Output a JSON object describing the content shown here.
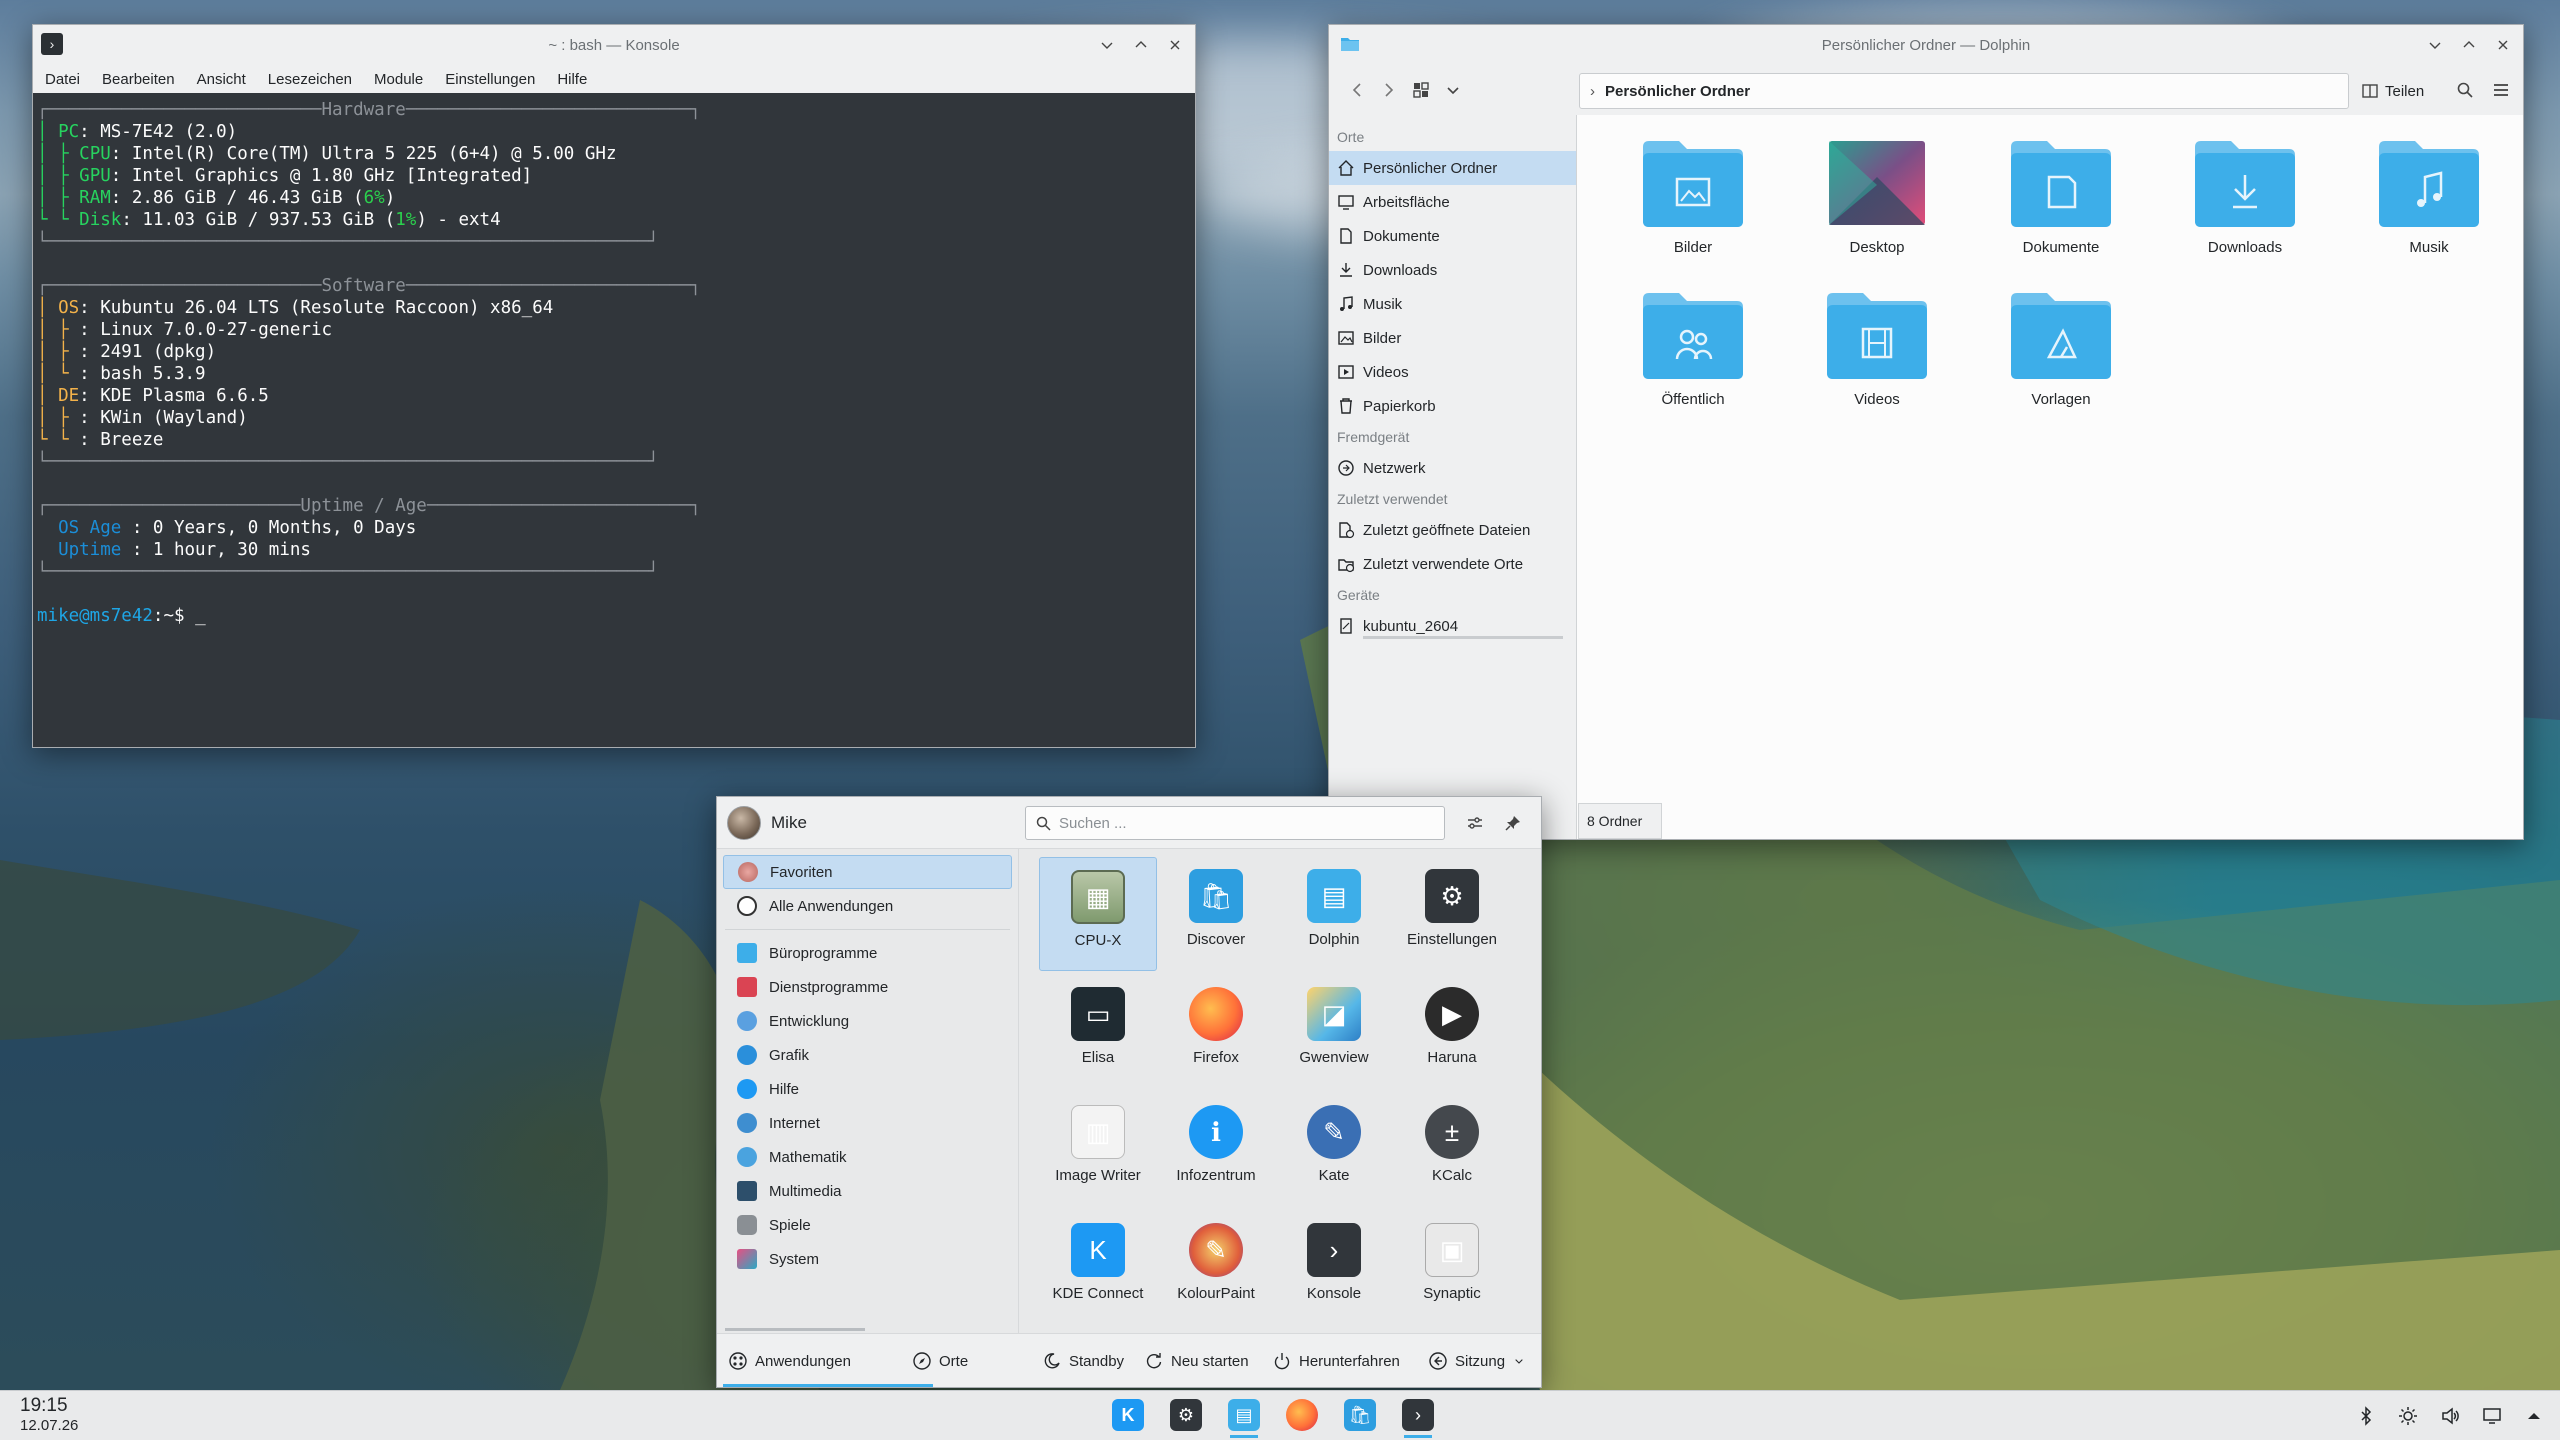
{
  "konsole": {
    "title": "~ : bash — Konsole",
    "menu": [
      "Datei",
      "Bearbeiten",
      "Ansicht",
      "Lesezeichen",
      "Module",
      "Einstellungen",
      "Hilfe"
    ],
    "sections": {
      "hardware": "Hardware",
      "software": "Software",
      "uptime": "Uptime / Age"
    },
    "hardware": [
      {
        "label": "PC",
        "value": ": MS-7E42 (2.0)"
      },
      {
        "label": "CPU",
        "value": ": Intel(R) Core(TM) Ultra 5 225 (6+4) @ 5.00 GHz"
      },
      {
        "label": "GPU",
        "value": ": Intel Graphics @ 1.80 GHz [Integrated]"
      },
      {
        "label": "RAM",
        "value_pre": ": 2.86 GiB / 46.43 GiB (",
        "value_pct": "6%",
        "value_post": ")"
      },
      {
        "label": "Disk",
        "value_pre": ": 11.03 GiB / 937.53 GiB (",
        "value_pct": "1%",
        "value_post": ") - ext4"
      }
    ],
    "software": [
      {
        "label": "OS",
        "value": ": Kubuntu 26.04 LTS (Resolute Raccoon) x86_64"
      },
      {
        "label": "",
        "value": ": Linux 7.0.0-27-generic"
      },
      {
        "label": "",
        "value": ": 2491 (dpkg)"
      },
      {
        "label": "",
        "value": ": bash 5.3.9"
      },
      {
        "label": "DE",
        "value": ": KDE Plasma 6.6.5"
      },
      {
        "label": "",
        "value": ": KWin (Wayland)"
      },
      {
        "label": "",
        "value": ": Breeze"
      }
    ],
    "age": [
      {
        "label": "OS Age",
        "value": " : 0 Years, 0 Months, 0 Days"
      },
      {
        "label": "Uptime",
        "value": " : 1 hour, 30 mins"
      }
    ],
    "prompt_user": "mike@ms7e42",
    "prompt_rest": ":~$ ",
    "cursor": "_"
  },
  "dolphin": {
    "title": "Persönlicher Ordner — Dolphin",
    "breadcrumb": "Persönlicher Ordner",
    "share_label": "Teilen",
    "sidebar": {
      "places_head": "Orte",
      "places": [
        "Persönlicher Ordner",
        "Arbeitsfläche",
        "Dokumente",
        "Downloads",
        "Musik",
        "Bilder",
        "Videos",
        "Papierkorb"
      ],
      "remote_head": "Fremdgerät",
      "remote": [
        "Netzwerk"
      ],
      "recent_head": "Zuletzt verwendet",
      "recent": [
        "Zuletzt geöffnete Dateien",
        "Zuletzt verwendete Orte"
      ],
      "devices_head": "Geräte",
      "devices": [
        "kubuntu_2604"
      ]
    },
    "folders": [
      "Bilder",
      "Desktop",
      "Dokumente",
      "Downloads",
      "Musik",
      "Öffentlich",
      "Videos",
      "Vorlagen"
    ],
    "status": "8 Ordner",
    "folder_color": "#3daee9"
  },
  "launcher": {
    "user": "Mike",
    "search_placeholder": "Suchen ...",
    "categories_top": [
      "Favoriten",
      "Alle Anwendungen"
    ],
    "categories": [
      "Büroprogramme",
      "Dienstprogramme",
      "Entwicklung",
      "Grafik",
      "Hilfe",
      "Internet",
      "Mathematik",
      "Multimedia",
      "Spiele",
      "System"
    ],
    "apps": [
      "CPU-X",
      "Discover",
      "Dolphin",
      "Einstellungen",
      "Elisa",
      "Firefox",
      "Gwenview",
      "Haruna",
      "Image Writer",
      "Infozentrum",
      "Kate",
      "KCalc",
      "KDE Connect",
      "KolourPaint",
      "Konsole",
      "Synaptic"
    ],
    "footer": {
      "apps": "Anwendungen",
      "places": "Orte",
      "standby": "Standby",
      "restart": "Neu starten",
      "shutdown": "Herunterfahren",
      "session": "Sitzung"
    },
    "accent": "#3daee9"
  },
  "taskbar": {
    "time": "19:15",
    "date": "12.07.26"
  }
}
